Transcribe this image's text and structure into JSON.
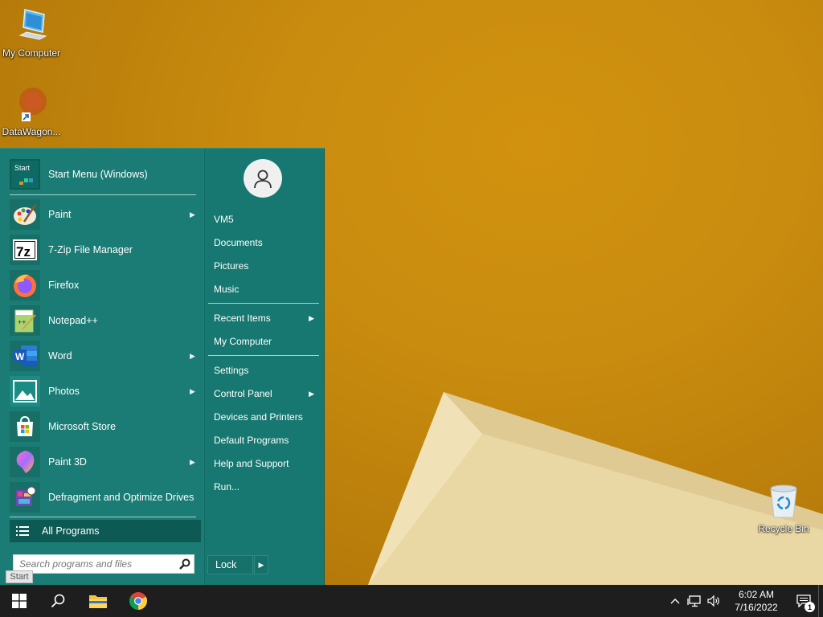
{
  "desktop": {
    "icons": [
      {
        "label": "My Computer"
      },
      {
        "label": "DataWagon..."
      },
      {
        "label": "Recycle Bin"
      }
    ]
  },
  "start_menu": {
    "header": {
      "label": "Start Menu (Windows)",
      "icon": "start-menu-icon",
      "icon_text": "Start"
    },
    "programs": [
      {
        "label": "Paint",
        "icon": "paint-icon",
        "has_submenu": true
      },
      {
        "label": "7-Zip File Manager",
        "icon": "7zip-icon",
        "icon_text": "7z",
        "has_submenu": false
      },
      {
        "label": "Firefox",
        "icon": "firefox-icon",
        "has_submenu": false
      },
      {
        "label": "Notepad++",
        "icon": "notepadpp-icon",
        "has_submenu": false
      },
      {
        "label": "Word",
        "icon": "word-icon",
        "icon_text": "W",
        "has_submenu": true
      },
      {
        "label": "Photos",
        "icon": "photos-icon",
        "has_submenu": true
      },
      {
        "label": "Microsoft Store",
        "icon": "store-icon",
        "has_submenu": false
      },
      {
        "label": "Paint 3D",
        "icon": "paint3d-icon",
        "has_submenu": true
      },
      {
        "label": "Defragment and Optimize Drives",
        "icon": "defrag-icon",
        "has_submenu": false
      }
    ],
    "all_programs": "All Programs",
    "search": {
      "placeholder": "Search programs and files"
    },
    "right": {
      "user_items": [
        "VM5",
        "Documents",
        "Pictures",
        "Music"
      ],
      "recent_items": "Recent Items",
      "my_computer": "My Computer",
      "settings": "Settings",
      "control_panel": "Control Panel",
      "devices": "Devices and Printers",
      "default_programs": "Default Programs",
      "help": "Help and Support",
      "run": "Run..."
    },
    "lock": "Lock",
    "tooltip": "Start"
  },
  "taskbar": {
    "pinned": [
      "start-button",
      "search-button",
      "file-explorer",
      "chrome"
    ],
    "clock_time": "6:02 AM",
    "clock_date": "7/16/2022",
    "notification_count": "1"
  },
  "colors": {
    "menu_bg": "#1a7c74",
    "all_programs_bg": "#0d5a55",
    "taskbar_bg": "#1e1e1e",
    "wallpaper": "#c98c0f"
  }
}
